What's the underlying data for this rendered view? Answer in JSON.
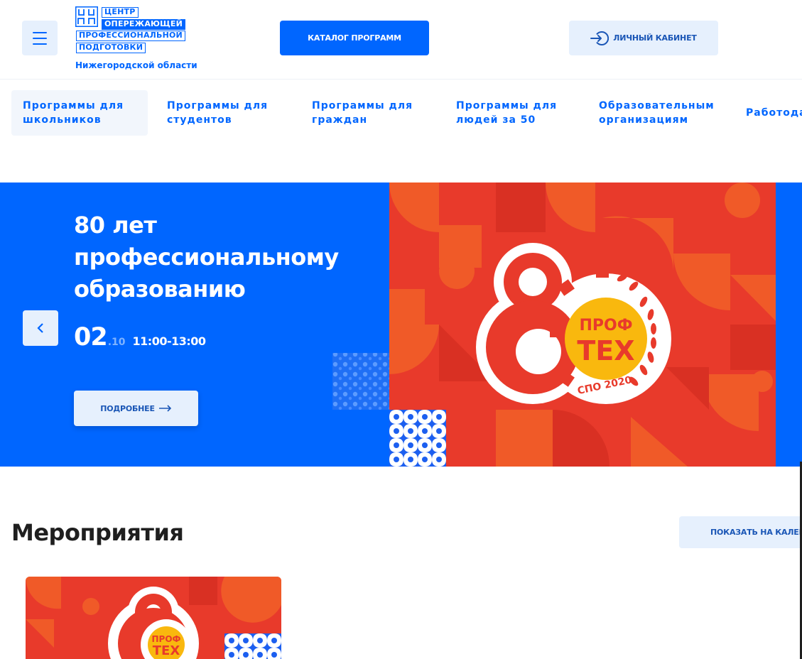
{
  "header": {
    "logo": {
      "mark": "ЦО ПП",
      "line1": "ЦЕНТР",
      "line2": "ОПЕРЕЖАЮЩЕЙ",
      "line3": "ПРОФЕССИОНАЛЬНОЙ",
      "line4": "ПОДГОТОВКИ",
      "region": "Нижегородской области"
    },
    "menu_icon": "hamburger-icon",
    "catalog_label": "КАТАЛОГ ПРОГРАММ",
    "cabinet_label": "ЛИЧНЫЙ КАБИНЕТ",
    "cabinet_icon": "login-icon"
  },
  "nav": {
    "items": [
      {
        "label": "Программы для\nшкольников",
        "active": true
      },
      {
        "label": "Программы для\nстудентов"
      },
      {
        "label": "Программы для\nграждан"
      },
      {
        "label": "Программы для\nлюдей за 50"
      },
      {
        "label": "Образовательным\nорганизациям"
      },
      {
        "label": "Работода"
      }
    ]
  },
  "hero": {
    "title": "80 лет профессиональному образованию",
    "day": "02",
    "month": ".10",
    "time": "11:00-13:00",
    "more_label": "ПОДРОБНЕЕ",
    "prev_icon": "chevron-left-icon",
    "badge": {
      "line1": "ПРОФ",
      "line2": "ТЕХ",
      "ring": "СПО 2020"
    }
  },
  "events": {
    "title": "Мероприятия",
    "calendar_label": "ПОКАЗАТЬ НА КАЛЕН"
  },
  "colors": {
    "primary": "#0066ff",
    "light": "#e6f0fd",
    "hero_red": "#e83a2b",
    "hero_orange": "#f05a28",
    "badge_yellow": "#f9b80e",
    "dark_text": "#1f1f1f"
  }
}
